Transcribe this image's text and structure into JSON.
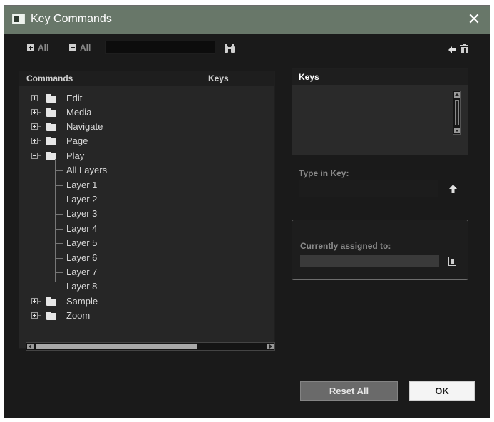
{
  "window": {
    "title": "Key Commands",
    "close_glyph": "✕"
  },
  "toolbar": {
    "expand_all_label": "All",
    "collapse_all_label": "All",
    "search_value": "",
    "search_icon": "binoculars-icon",
    "back_icon": "arrow-left-icon",
    "delete_icon": "trash-icon"
  },
  "commands": {
    "header_commands": "Commands",
    "header_keys": "Keys",
    "tree": [
      {
        "label": "Edit",
        "expanded": false
      },
      {
        "label": "Media",
        "expanded": false
      },
      {
        "label": "Navigate",
        "expanded": false
      },
      {
        "label": "Page",
        "expanded": false
      },
      {
        "label": "Play",
        "expanded": true,
        "children": [
          "All Layers",
          "Layer 1",
          "Layer 2",
          "Layer 3",
          "Layer 4",
          "Layer 5",
          "Layer 6",
          "Layer 7",
          "Layer 8"
        ]
      },
      {
        "label": "Sample",
        "expanded": false
      },
      {
        "label": "Zoom",
        "expanded": false
      }
    ]
  },
  "keys_panel": {
    "header": "Keys"
  },
  "type_in_key": {
    "label": "Type in Key:",
    "value": "",
    "add_icon": "arrow-up-icon"
  },
  "assigned": {
    "label": "Currently assigned to:",
    "value": "",
    "button_icon": "go-to-icon"
  },
  "buttons": {
    "reset_all": "Reset All",
    "ok": "OK"
  },
  "colors": {
    "titlebar": "#687769",
    "background": "#1a1a1a"
  }
}
